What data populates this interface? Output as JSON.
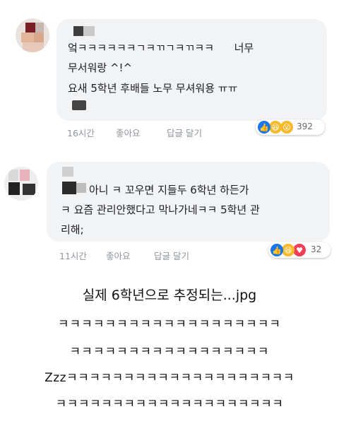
{
  "comments": [
    {
      "lines": [
        "엌ㅋㅋㅋㅋㅋㅋㄱㅋㄲㄱㅋㄲㅋㅋ      너무",
        "무서워랑 ^!^",
        "요새 5학년 후배들 노무 무셔워용 ㅠㅠ"
      ],
      "time": "16시간",
      "like_label": "좋아요",
      "reply_label": "답글 달기",
      "reaction_count": "392",
      "reactions": [
        "like-icon",
        "haha-icon",
        "wow-icon"
      ]
    },
    {
      "lines": [
        "아니 ㅋ 꼬우면 지들두 6학년 하든가",
        "ㅋ 요즘 관리안했다고 막나가네ㅋㅋ 5학년 관",
        "리해;"
      ],
      "time": "11시간",
      "like_label": "좋아요",
      "reply_label": "답글 달기",
      "reaction_count": "32",
      "reactions": [
        "like-icon",
        "haha-icon",
        "love-icon"
      ]
    }
  ],
  "caption": {
    "title": "실제 6학년으로 추정되는...jpg",
    "lines": [
      "ㅋㅋㅋㅋㅋㅋㅋㅋㅋㅋㅋㅋㅋㅋㅋㅋㅋㅋㅋ",
      "ㅋㅋㅋㅋㅋㅋㅋㅋㅋㅋㅋㅋㅋㅋㅋㅋㅋ",
      "Zzzㅋㅋㅋㅋㅋㅋㅋㅋㅋㅋㅋㅋㅋㅋㅋㅋㅋㅋㅋㅋ",
      "ㅋㅋㅋㅋㅋㅋㅋㅋㅋㅋㅋㅋㅋㅋㅋㅋㅋㅋㅋㅋ"
    ]
  },
  "colors": {
    "like": "#1877f2",
    "haha": "#f7b928",
    "love": "#f33e58",
    "meta_text": "#90949c",
    "bubble": "#f2f3f5"
  }
}
